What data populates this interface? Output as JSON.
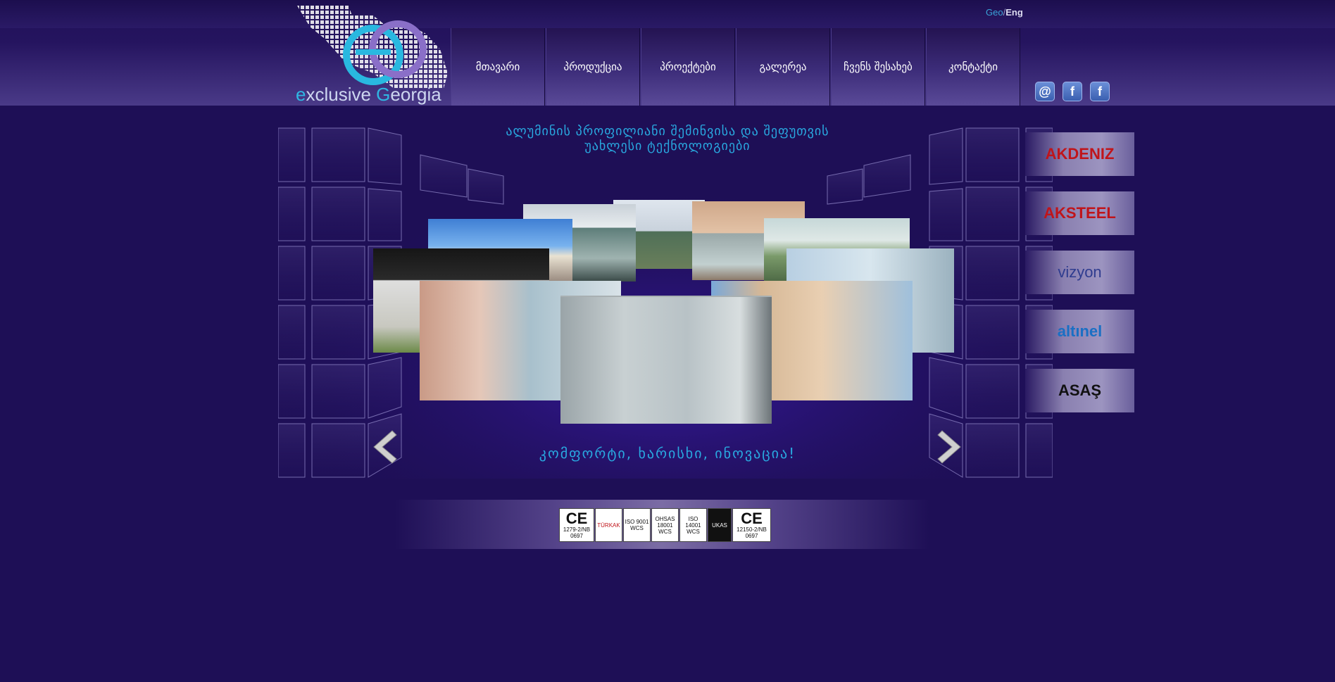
{
  "header": {
    "logo_text_prefix": "e",
    "logo_text_mid": "xclusive ",
    "logo_text_g": "G",
    "logo_text_suffix": "eorgia",
    "lang_geo": "Geo",
    "lang_sep": "/",
    "lang_eng": "Eng",
    "nav": [
      {
        "label": "მთავარი"
      },
      {
        "label": "პროდუქცია"
      },
      {
        "label": "პროექტები"
      },
      {
        "label": "გალერეა"
      },
      {
        "label": "ჩვენს შესახებ"
      },
      {
        "label": "კონტაქტი"
      }
    ],
    "social": [
      {
        "icon": "email-icon",
        "glyph": "@"
      },
      {
        "icon": "facebook-icon",
        "glyph": "f"
      },
      {
        "icon": "facebook-page-icon",
        "glyph": "f"
      }
    ]
  },
  "main": {
    "headline_line1": "ალუმინის პროფილიანი შემინვისა და შეფუთვის",
    "headline_line2": "უახლესი ტექნოლოგიები",
    "slogan": "კომფორტი, ხარისხი, ინოვაცია!"
  },
  "partners": [
    {
      "name": "AKDENIZ",
      "color": "#c0141a"
    },
    {
      "name": "AKSTEEL",
      "color": "#c0141a"
    },
    {
      "name": "vizyon",
      "color": "#2f3c8f"
    },
    {
      "name": "altınel",
      "color": "#1a6fc4"
    },
    {
      "name": "ASAŞ",
      "color": "#111111"
    }
  ],
  "certs": [
    {
      "top": "CE",
      "bottom": "1279-2/NB 0697"
    },
    {
      "top": "TÜRKAK",
      "bottom": ""
    },
    {
      "top": "ISO 9001",
      "bottom": "WCS"
    },
    {
      "top": "OHSAS 18001",
      "bottom": "WCS"
    },
    {
      "top": "ISO 14001",
      "bottom": "WCS"
    },
    {
      "top": "UKAS",
      "bottom": ""
    },
    {
      "top": "CE",
      "bottom": "12150-2/NB 0697"
    }
  ],
  "colors": {
    "background": "#1e0f56",
    "accent": "#29a9e0"
  }
}
